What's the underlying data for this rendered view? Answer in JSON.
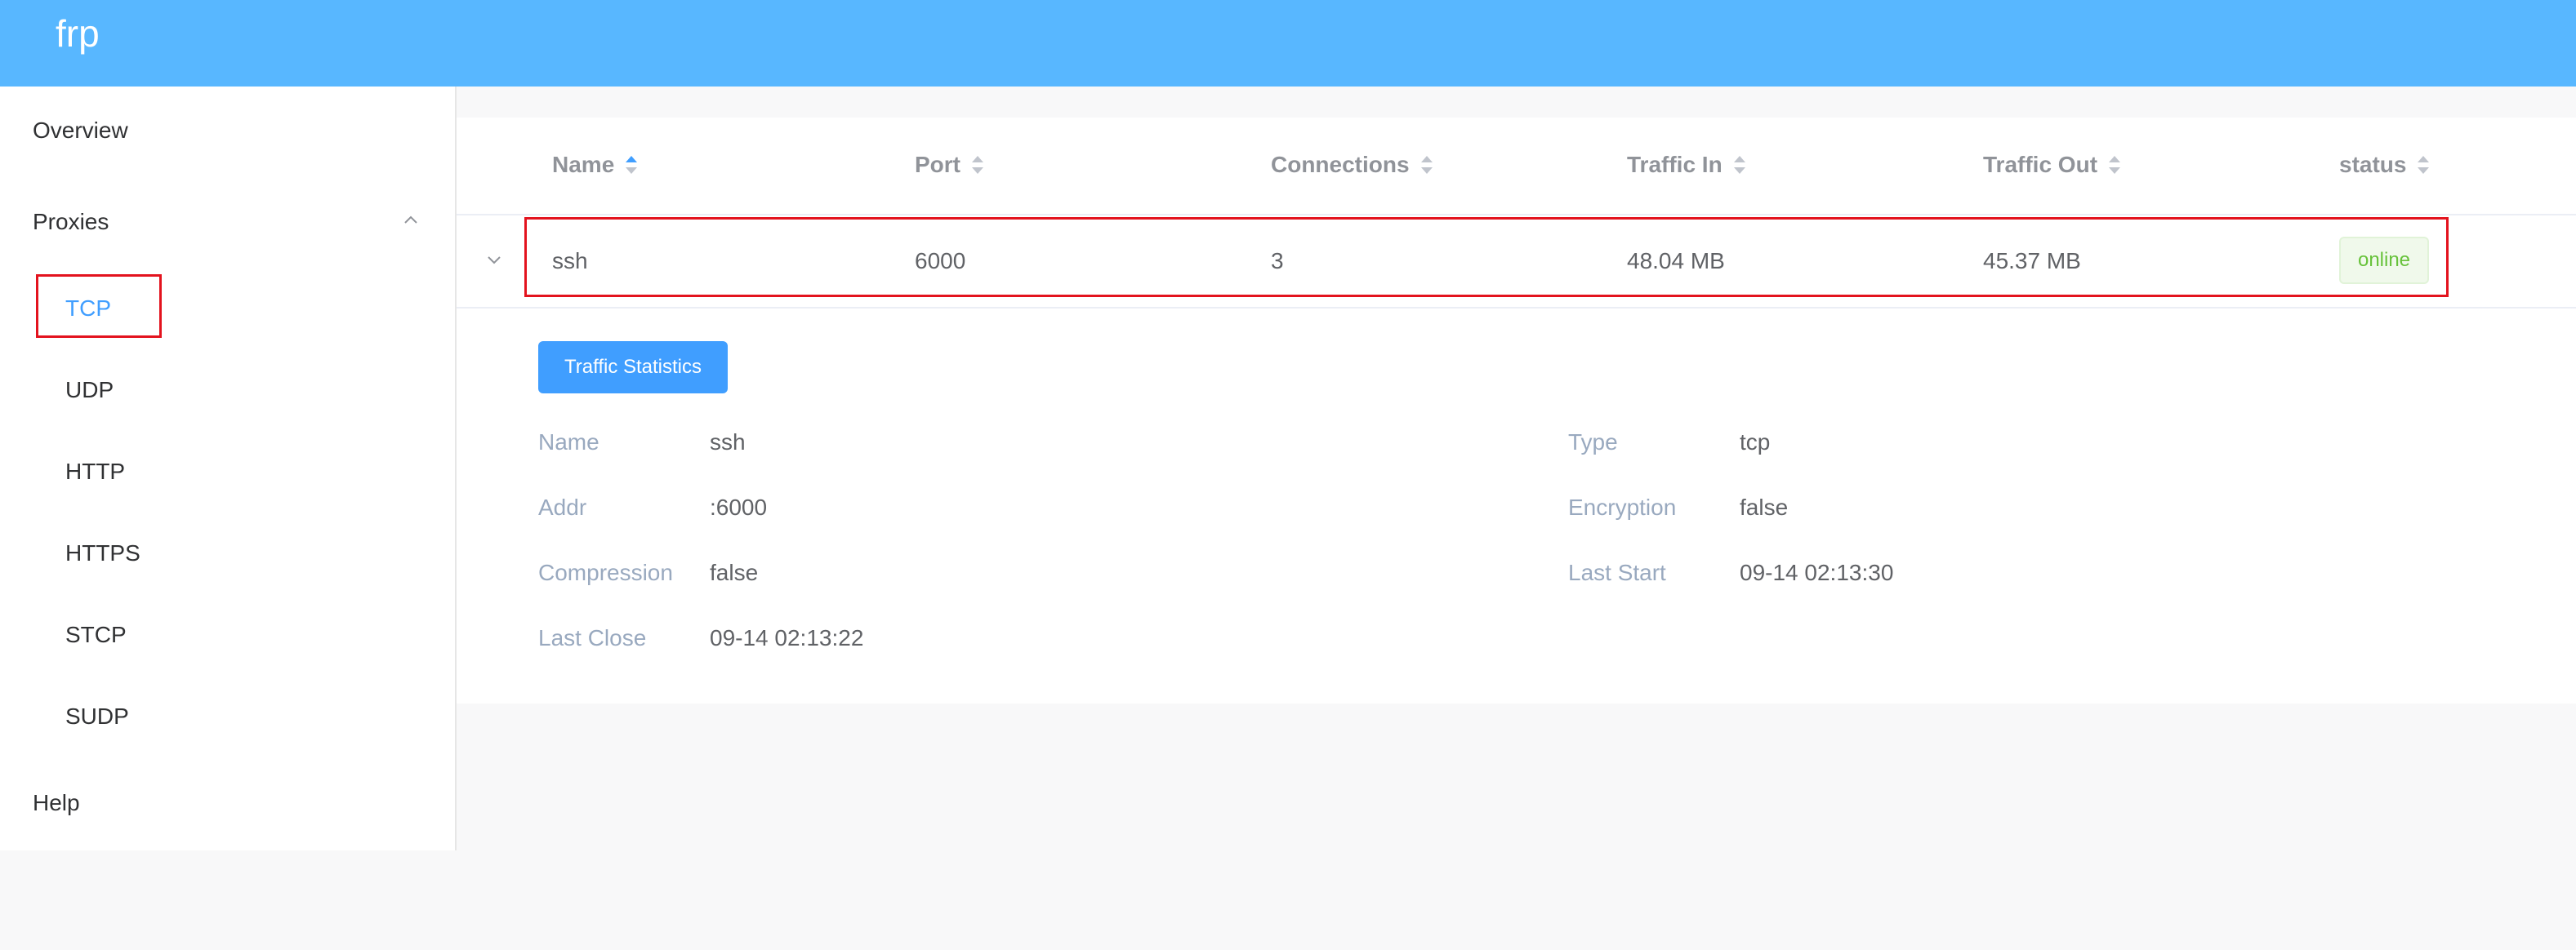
{
  "header": {
    "logo": "frp"
  },
  "sidebar": {
    "overview": "Overview",
    "proxies": "Proxies",
    "proxy_types": [
      "TCP",
      "UDP",
      "HTTP",
      "HTTPS",
      "STCP",
      "SUDP"
    ],
    "active": "TCP",
    "help": "Help"
  },
  "table": {
    "columns": [
      "Name",
      "Port",
      "Connections",
      "Traffic In",
      "Traffic Out",
      "status"
    ],
    "sorted_column": "Name",
    "rows": [
      {
        "name": "ssh",
        "port": "6000",
        "connections": "3",
        "traffic_in": "48.04 MB",
        "traffic_out": "45.37 MB",
        "status": "online"
      }
    ]
  },
  "detail": {
    "button": "Traffic Statistics",
    "fields": {
      "name_label": "Name",
      "name_value": "ssh",
      "type_label": "Type",
      "type_value": "tcp",
      "addr_label": "Addr",
      "addr_value": ":6000",
      "encryption_label": "Encryption",
      "encryption_value": "false",
      "compression_label": "Compression",
      "compression_value": "false",
      "last_start_label": "Last Start",
      "last_start_value": "09-14 02:13:30",
      "last_close_label": "Last Close",
      "last_close_value": "09-14 02:13:22"
    }
  },
  "colors": {
    "header": "#58b7ff",
    "accent": "#409eff",
    "highlight": "#e3131e",
    "online": "#67c23a"
  }
}
